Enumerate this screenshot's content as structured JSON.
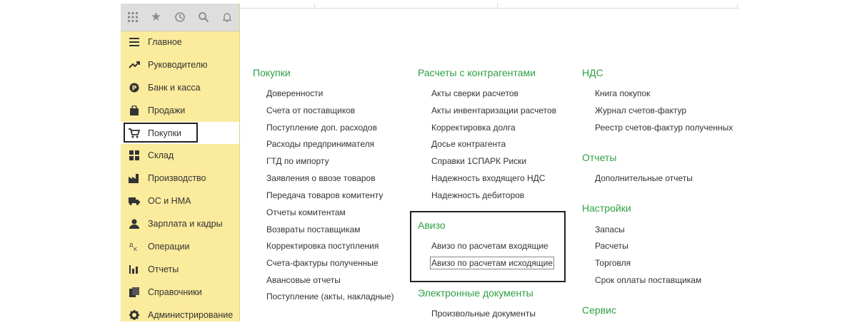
{
  "topbar_icons": [
    "apps-grid-icon",
    "star-icon",
    "history-icon",
    "search-icon",
    "bell-icon"
  ],
  "menu": [
    {
      "label": "Главное",
      "icon": "menu-lines-icon"
    },
    {
      "label": "Руководителю",
      "icon": "trend-icon"
    },
    {
      "label": "Банк и касса",
      "icon": "coin-icon"
    },
    {
      "label": "Продажи",
      "icon": "bag-icon"
    },
    {
      "label": "Покупки",
      "icon": "cart-icon",
      "active": true
    },
    {
      "label": "Склад",
      "icon": "warehouse-icon"
    },
    {
      "label": "Производство",
      "icon": "factory-icon"
    },
    {
      "label": "ОС и НМА",
      "icon": "truck-icon"
    },
    {
      "label": "Зарплата и кадры",
      "icon": "person-icon"
    },
    {
      "label": "Операции",
      "icon": "operations-icon"
    },
    {
      "label": "Отчеты",
      "icon": "bar-chart-icon"
    },
    {
      "label": "Справочники",
      "icon": "books-icon"
    },
    {
      "label": "Администрирование",
      "icon": "gear-icon"
    }
  ],
  "sections": {
    "pokupki": {
      "title": "Покупки",
      "items": [
        "Доверенности",
        "Счета от поставщиков",
        "Поступление доп. расходов",
        "Расходы предпринимателя",
        "ГТД по импорту",
        "Заявления о ввозе товаров",
        "Передача товаров комитенту",
        "Отчеты комитентам",
        "Возвраты поставщикам",
        "Корректировка поступления",
        "Счета-фактуры полученные",
        "Авансовые отчеты",
        "Поступление (акты, накладные)"
      ]
    },
    "raschety": {
      "title": "Расчеты с контрагентами",
      "items": [
        "Акты сверки расчетов",
        "Акты инвентаризации расчетов",
        "Корректировка долга",
        "Досье контрагента",
        "Справки 1СПАРК Риски",
        "Надежность входящего НДС",
        "Надежность дебиторов"
      ]
    },
    "avizo": {
      "title": "Авизо",
      "items": [
        "Авизо по расчетам входящие",
        "Авизо по расчетам исходящие"
      ]
    },
    "edo": {
      "title": "Электронные документы",
      "items": [
        "Произвольные документы"
      ]
    },
    "nds": {
      "title": "НДС",
      "items": [
        "Книга покупок",
        "Журнал счетов-фактур",
        "Реестр счетов-фактур полученных"
      ]
    },
    "otchety": {
      "title": "Отчеты",
      "items": [
        "Дополнительные отчеты"
      ]
    },
    "nastroiki": {
      "title": "Настройки",
      "items": [
        "Запасы",
        "Расчеты",
        "Торговля",
        "Срок оплаты поставщикам"
      ]
    },
    "servis": {
      "title": "Сервис",
      "items": []
    }
  },
  "colors": {
    "sidebar": "#fbeb9c",
    "section_title": "#2ea043",
    "text": "#333333"
  }
}
